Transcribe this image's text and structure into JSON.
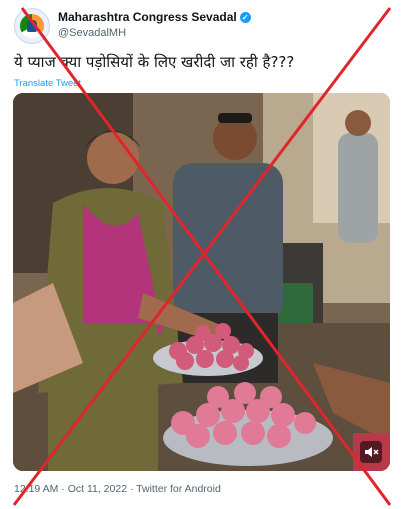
{
  "tweet": {
    "author_name": "Maharashtra Congress Sevadal",
    "author_handle": "@SevadalMH",
    "text": "ये प्याज क्या पड़ोसियों के लिए खरीदी जा रही है???",
    "translate_label": "Translate Tweet",
    "timestamp": "12:19 AM · Oct 11, 2022 · Twitter for Android"
  },
  "media": {
    "mute_icon": "speaker-muted-icon"
  },
  "colors": {
    "link": "#1d9bf0",
    "cross": "#e0262b"
  },
  "overlay_icon": "red-cross-icon"
}
